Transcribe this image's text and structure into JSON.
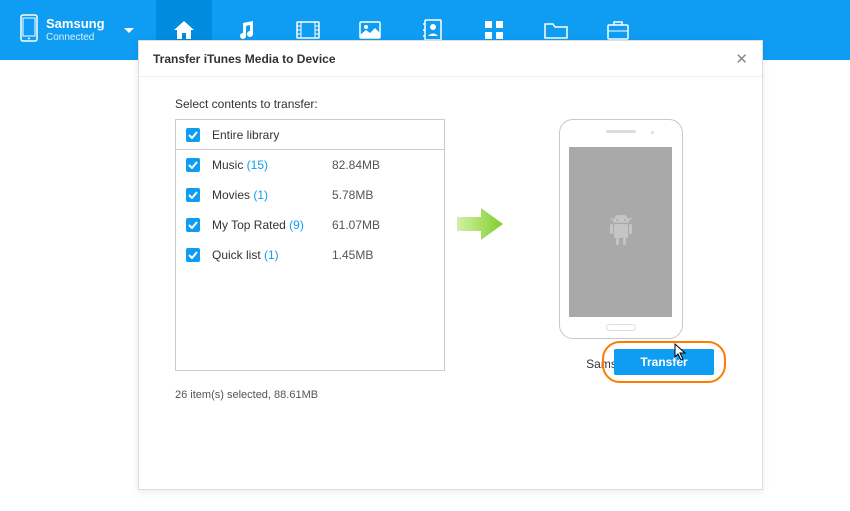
{
  "device": {
    "name": "Samsung",
    "status": "Connected"
  },
  "modal": {
    "title": "Transfer iTunes Media to Device",
    "subtitle": "Select contents to transfer:",
    "entire_label": "Entire library",
    "items": [
      {
        "label": "Music",
        "count": "(15)",
        "size": "82.84MB"
      },
      {
        "label": "Movies",
        "count": "(1)",
        "size": "5.78MB"
      },
      {
        "label": "My Top Rated",
        "count": "(9)",
        "size": "61.07MB"
      },
      {
        "label": "Quick list",
        "count": "(1)",
        "size": "1.45MB"
      }
    ],
    "phone_name": "Samsung S6",
    "summary": "26 item(s) selected, 88.61MB",
    "transfer_label": "Transfer"
  }
}
